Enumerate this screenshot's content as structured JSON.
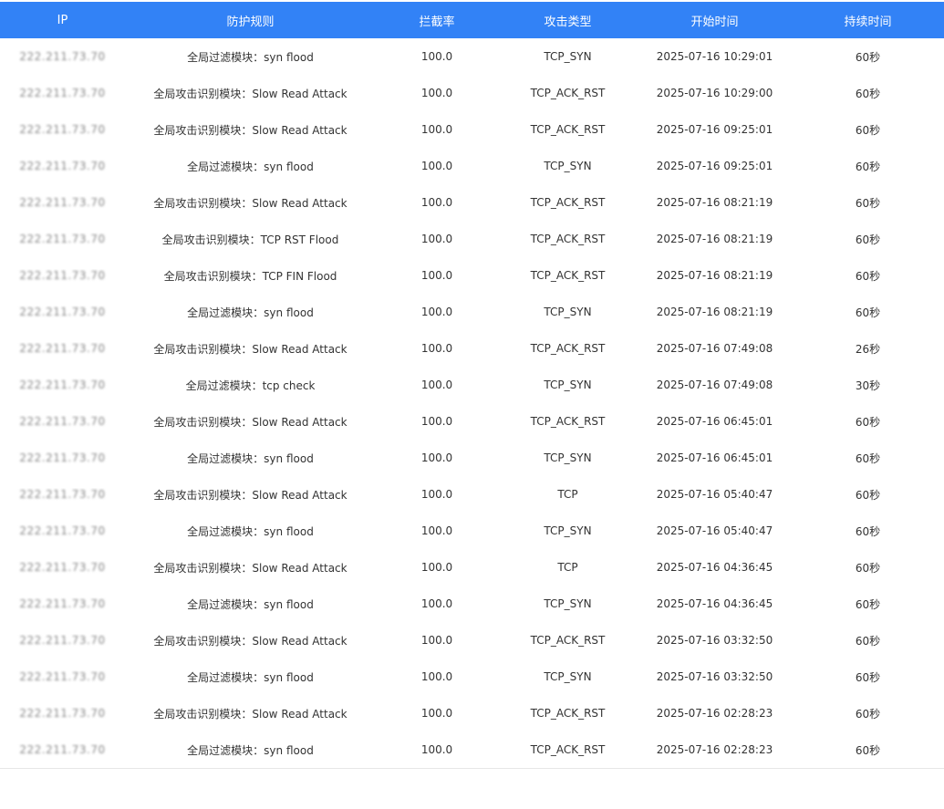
{
  "table": {
    "headers": {
      "ip": "IP",
      "rule": "防护规则",
      "rate": "拦截率",
      "type": "攻击类型",
      "start": "开始时间",
      "duration": "持续时间"
    },
    "accent_color": "#3282f6",
    "rows": [
      {
        "ip": "222.211.73.70",
        "rule": "全局过滤模块：syn flood",
        "rate": "100.0",
        "type": "TCP_SYN",
        "start": "2025-07-16 10:29:01",
        "duration": "60秒"
      },
      {
        "ip": "222.211.73.70",
        "rule": "全局攻击识别模块：Slow Read Attack",
        "rate": "100.0",
        "type": "TCP_ACK_RST",
        "start": "2025-07-16 10:29:00",
        "duration": "60秒"
      },
      {
        "ip": "222.211.73.70",
        "rule": "全局攻击识别模块：Slow Read Attack",
        "rate": "100.0",
        "type": "TCP_ACK_RST",
        "start": "2025-07-16 09:25:01",
        "duration": "60秒"
      },
      {
        "ip": "222.211.73.70",
        "rule": "全局过滤模块：syn flood",
        "rate": "100.0",
        "type": "TCP_SYN",
        "start": "2025-07-16 09:25:01",
        "duration": "60秒"
      },
      {
        "ip": "222.211.73.70",
        "rule": "全局攻击识别模块：Slow Read Attack",
        "rate": "100.0",
        "type": "TCP_ACK_RST",
        "start": "2025-07-16 08:21:19",
        "duration": "60秒"
      },
      {
        "ip": "222.211.73.70",
        "rule": "全局攻击识别模块：TCP RST Flood",
        "rate": "100.0",
        "type": "TCP_ACK_RST",
        "start": "2025-07-16 08:21:19",
        "duration": "60秒"
      },
      {
        "ip": "222.211.73.70",
        "rule": "全局攻击识别模块：TCP FIN Flood",
        "rate": "100.0",
        "type": "TCP_ACK_RST",
        "start": "2025-07-16 08:21:19",
        "duration": "60秒"
      },
      {
        "ip": "222.211.73.70",
        "rule": "全局过滤模块：syn flood",
        "rate": "100.0",
        "type": "TCP_SYN",
        "start": "2025-07-16 08:21:19",
        "duration": "60秒"
      },
      {
        "ip": "222.211.73.70",
        "rule": "全局攻击识别模块：Slow Read Attack",
        "rate": "100.0",
        "type": "TCP_ACK_RST",
        "start": "2025-07-16 07:49:08",
        "duration": "26秒"
      },
      {
        "ip": "222.211.73.70",
        "rule": "全局过滤模块：tcp check",
        "rate": "100.0",
        "type": "TCP_SYN",
        "start": "2025-07-16 07:49:08",
        "duration": "30秒"
      },
      {
        "ip": "222.211.73.70",
        "rule": "全局攻击识别模块：Slow Read Attack",
        "rate": "100.0",
        "type": "TCP_ACK_RST",
        "start": "2025-07-16 06:45:01",
        "duration": "60秒"
      },
      {
        "ip": "222.211.73.70",
        "rule": "全局过滤模块：syn flood",
        "rate": "100.0",
        "type": "TCP_SYN",
        "start": "2025-07-16 06:45:01",
        "duration": "60秒"
      },
      {
        "ip": "222.211.73.70",
        "rule": "全局攻击识别模块：Slow Read Attack",
        "rate": "100.0",
        "type": "TCP",
        "start": "2025-07-16 05:40:47",
        "duration": "60秒"
      },
      {
        "ip": "222.211.73.70",
        "rule": "全局过滤模块：syn flood",
        "rate": "100.0",
        "type": "TCP_SYN",
        "start": "2025-07-16 05:40:47",
        "duration": "60秒"
      },
      {
        "ip": "222.211.73.70",
        "rule": "全局攻击识别模块：Slow Read Attack",
        "rate": "100.0",
        "type": "TCP",
        "start": "2025-07-16 04:36:45",
        "duration": "60秒"
      },
      {
        "ip": "222.211.73.70",
        "rule": "全局过滤模块：syn flood",
        "rate": "100.0",
        "type": "TCP_SYN",
        "start": "2025-07-16 04:36:45",
        "duration": "60秒"
      },
      {
        "ip": "222.211.73.70",
        "rule": "全局攻击识别模块：Slow Read Attack",
        "rate": "100.0",
        "type": "TCP_ACK_RST",
        "start": "2025-07-16 03:32:50",
        "duration": "60秒"
      },
      {
        "ip": "222.211.73.70",
        "rule": "全局过滤模块：syn flood",
        "rate": "100.0",
        "type": "TCP_SYN",
        "start": "2025-07-16 03:32:50",
        "duration": "60秒"
      },
      {
        "ip": "222.211.73.70",
        "rule": "全局攻击识别模块：Slow Read Attack",
        "rate": "100.0",
        "type": "TCP_ACK_RST",
        "start": "2025-07-16 02:28:23",
        "duration": "60秒"
      },
      {
        "ip": "222.211.73.70",
        "rule": "全局过滤模块：syn flood",
        "rate": "100.0",
        "type": "TCP_ACK_RST",
        "start": "2025-07-16 02:28:23",
        "duration": "60秒"
      }
    ]
  }
}
